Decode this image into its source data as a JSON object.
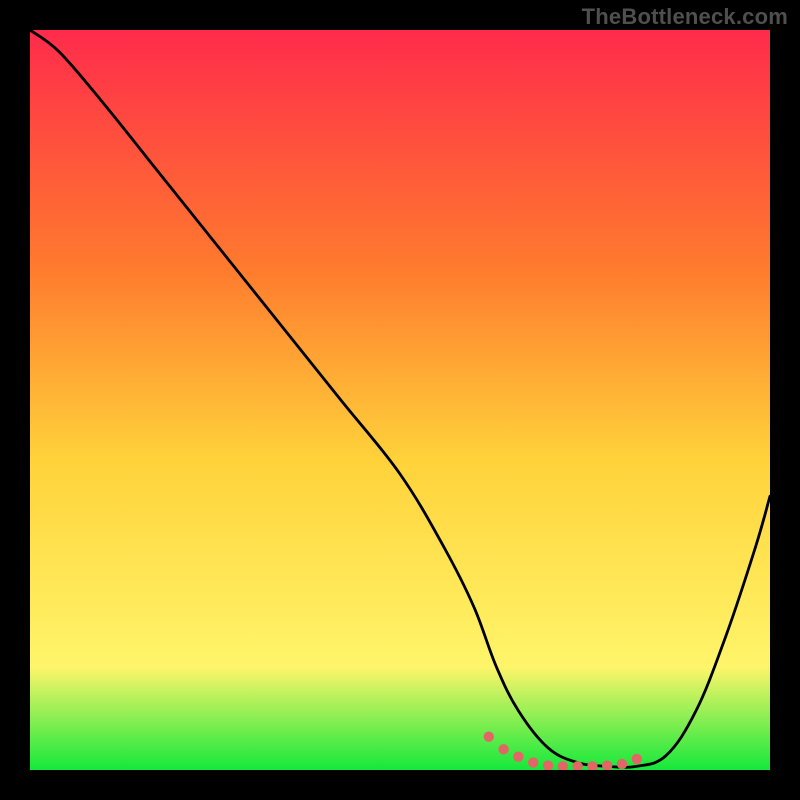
{
  "watermark": "TheBottleneck.com",
  "colors": {
    "background": "#000000",
    "gradient_top": "#ff2b4b",
    "gradient_mid_upper": "#ff7a2e",
    "gradient_mid": "#ffd23a",
    "gradient_low": "#fff56a",
    "gradient_bottom": "#15e83b",
    "curve": "#000000",
    "marker": "#e26666"
  },
  "chart_data": {
    "type": "line",
    "title": "",
    "xlabel": "",
    "ylabel": "",
    "xlim": [
      0,
      100
    ],
    "ylim": [
      0,
      100
    ],
    "series": [
      {
        "name": "bottleneck-curve",
        "x": [
          0,
          4,
          10,
          18,
          26,
          34,
          42,
          50,
          56,
          60,
          63,
          66,
          70,
          74,
          78,
          82,
          86,
          90,
          94,
          98,
          100
        ],
        "values": [
          100,
          97,
          90,
          80,
          70,
          60,
          50,
          40,
          30,
          22,
          14,
          8,
          3,
          1,
          0.5,
          0.5,
          2,
          8,
          18,
          30,
          37
        ]
      }
    ],
    "markers": {
      "name": "highlight-region",
      "x": [
        62,
        64,
        66,
        68,
        70,
        72,
        74,
        76,
        78,
        80,
        82
      ],
      "values": [
        4.5,
        2.8,
        1.8,
        1.0,
        0.6,
        0.5,
        0.5,
        0.5,
        0.6,
        0.8,
        1.5
      ]
    }
  }
}
